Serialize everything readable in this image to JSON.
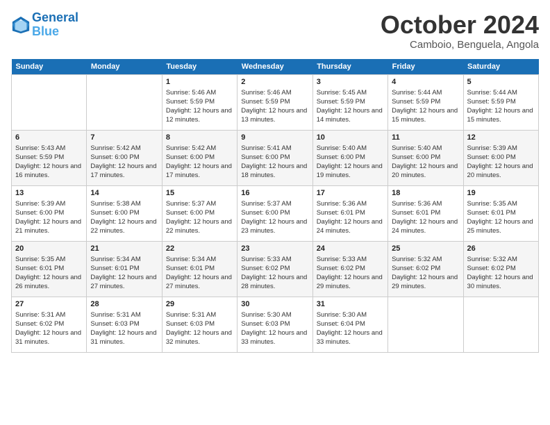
{
  "header": {
    "logo_line1": "General",
    "logo_line2": "Blue",
    "month_year": "October 2024",
    "location": "Camboio, Benguela, Angola"
  },
  "days_of_week": [
    "Sunday",
    "Monday",
    "Tuesday",
    "Wednesday",
    "Thursday",
    "Friday",
    "Saturday"
  ],
  "weeks": [
    [
      {
        "day": "",
        "info": ""
      },
      {
        "day": "",
        "info": ""
      },
      {
        "day": "1",
        "info": "Sunrise: 5:46 AM\nSunset: 5:59 PM\nDaylight: 12 hours and 12 minutes."
      },
      {
        "day": "2",
        "info": "Sunrise: 5:46 AM\nSunset: 5:59 PM\nDaylight: 12 hours and 13 minutes."
      },
      {
        "day": "3",
        "info": "Sunrise: 5:45 AM\nSunset: 5:59 PM\nDaylight: 12 hours and 14 minutes."
      },
      {
        "day": "4",
        "info": "Sunrise: 5:44 AM\nSunset: 5:59 PM\nDaylight: 12 hours and 15 minutes."
      },
      {
        "day": "5",
        "info": "Sunrise: 5:44 AM\nSunset: 5:59 PM\nDaylight: 12 hours and 15 minutes."
      }
    ],
    [
      {
        "day": "6",
        "info": "Sunrise: 5:43 AM\nSunset: 5:59 PM\nDaylight: 12 hours and 16 minutes."
      },
      {
        "day": "7",
        "info": "Sunrise: 5:42 AM\nSunset: 6:00 PM\nDaylight: 12 hours and 17 minutes."
      },
      {
        "day": "8",
        "info": "Sunrise: 5:42 AM\nSunset: 6:00 PM\nDaylight: 12 hours and 17 minutes."
      },
      {
        "day": "9",
        "info": "Sunrise: 5:41 AM\nSunset: 6:00 PM\nDaylight: 12 hours and 18 minutes."
      },
      {
        "day": "10",
        "info": "Sunrise: 5:40 AM\nSunset: 6:00 PM\nDaylight: 12 hours and 19 minutes."
      },
      {
        "day": "11",
        "info": "Sunrise: 5:40 AM\nSunset: 6:00 PM\nDaylight: 12 hours and 20 minutes."
      },
      {
        "day": "12",
        "info": "Sunrise: 5:39 AM\nSunset: 6:00 PM\nDaylight: 12 hours and 20 minutes."
      }
    ],
    [
      {
        "day": "13",
        "info": "Sunrise: 5:39 AM\nSunset: 6:00 PM\nDaylight: 12 hours and 21 minutes."
      },
      {
        "day": "14",
        "info": "Sunrise: 5:38 AM\nSunset: 6:00 PM\nDaylight: 12 hours and 22 minutes."
      },
      {
        "day": "15",
        "info": "Sunrise: 5:37 AM\nSunset: 6:00 PM\nDaylight: 12 hours and 22 minutes."
      },
      {
        "day": "16",
        "info": "Sunrise: 5:37 AM\nSunset: 6:00 PM\nDaylight: 12 hours and 23 minutes."
      },
      {
        "day": "17",
        "info": "Sunrise: 5:36 AM\nSunset: 6:01 PM\nDaylight: 12 hours and 24 minutes."
      },
      {
        "day": "18",
        "info": "Sunrise: 5:36 AM\nSunset: 6:01 PM\nDaylight: 12 hours and 24 minutes."
      },
      {
        "day": "19",
        "info": "Sunrise: 5:35 AM\nSunset: 6:01 PM\nDaylight: 12 hours and 25 minutes."
      }
    ],
    [
      {
        "day": "20",
        "info": "Sunrise: 5:35 AM\nSunset: 6:01 PM\nDaylight: 12 hours and 26 minutes."
      },
      {
        "day": "21",
        "info": "Sunrise: 5:34 AM\nSunset: 6:01 PM\nDaylight: 12 hours and 27 minutes."
      },
      {
        "day": "22",
        "info": "Sunrise: 5:34 AM\nSunset: 6:01 PM\nDaylight: 12 hours and 27 minutes."
      },
      {
        "day": "23",
        "info": "Sunrise: 5:33 AM\nSunset: 6:02 PM\nDaylight: 12 hours and 28 minutes."
      },
      {
        "day": "24",
        "info": "Sunrise: 5:33 AM\nSunset: 6:02 PM\nDaylight: 12 hours and 29 minutes."
      },
      {
        "day": "25",
        "info": "Sunrise: 5:32 AM\nSunset: 6:02 PM\nDaylight: 12 hours and 29 minutes."
      },
      {
        "day": "26",
        "info": "Sunrise: 5:32 AM\nSunset: 6:02 PM\nDaylight: 12 hours and 30 minutes."
      }
    ],
    [
      {
        "day": "27",
        "info": "Sunrise: 5:31 AM\nSunset: 6:02 PM\nDaylight: 12 hours and 31 minutes."
      },
      {
        "day": "28",
        "info": "Sunrise: 5:31 AM\nSunset: 6:03 PM\nDaylight: 12 hours and 31 minutes."
      },
      {
        "day": "29",
        "info": "Sunrise: 5:31 AM\nSunset: 6:03 PM\nDaylight: 12 hours and 32 minutes."
      },
      {
        "day": "30",
        "info": "Sunrise: 5:30 AM\nSunset: 6:03 PM\nDaylight: 12 hours and 33 minutes."
      },
      {
        "day": "31",
        "info": "Sunrise: 5:30 AM\nSunset: 6:04 PM\nDaylight: 12 hours and 33 minutes."
      },
      {
        "day": "",
        "info": ""
      },
      {
        "day": "",
        "info": ""
      }
    ]
  ]
}
